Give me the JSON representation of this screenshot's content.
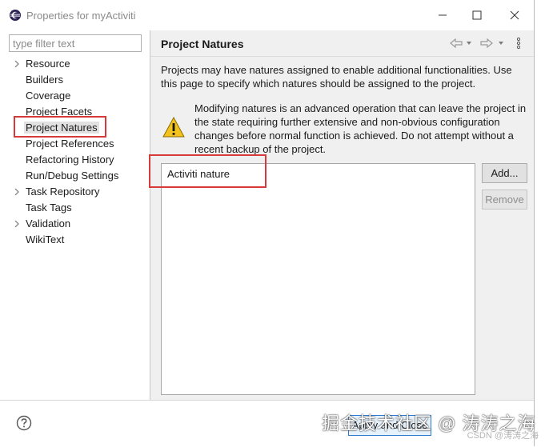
{
  "window": {
    "title": "Properties for myActiviti"
  },
  "filter": {
    "placeholder": "type filter text"
  },
  "tree": {
    "items": [
      {
        "label": "Resource",
        "expandable": true
      },
      {
        "label": "Builders",
        "expandable": false
      },
      {
        "label": "Coverage",
        "expandable": false
      },
      {
        "label": "Project Facets",
        "expandable": false
      },
      {
        "label": "Project Natures",
        "expandable": false,
        "selected": true
      },
      {
        "label": "Project References",
        "expandable": false
      },
      {
        "label": "Refactoring History",
        "expandable": false
      },
      {
        "label": "Run/Debug Settings",
        "expandable": false
      },
      {
        "label": "Task Repository",
        "expandable": true
      },
      {
        "label": "Task Tags",
        "expandable": false
      },
      {
        "label": "Validation",
        "expandable": true
      },
      {
        "label": "WikiText",
        "expandable": false
      }
    ]
  },
  "page": {
    "title": "Project Natures",
    "description": "Projects may have natures assigned to enable additional functionalities. Use this page to specify which natures should be assigned to the project.",
    "warning": "Modifying natures is an advanced operation that can leave the project in the state requiring further extensive and non-obvious configuration changes before normal function is achieved. Do not attempt without a recent backup of the project.",
    "natures": [
      "Activiti nature"
    ],
    "add_label": "Add...",
    "remove_label": "Remove"
  },
  "footer": {
    "apply_close_label": "Apply and Close",
    "watermark": "掘金技术社区 @ 涛涛之海",
    "csdn": "CSDN @涛涛之海"
  },
  "colors": {
    "highlight_box": "#d63a3a",
    "accent": "#2b7ad0"
  }
}
